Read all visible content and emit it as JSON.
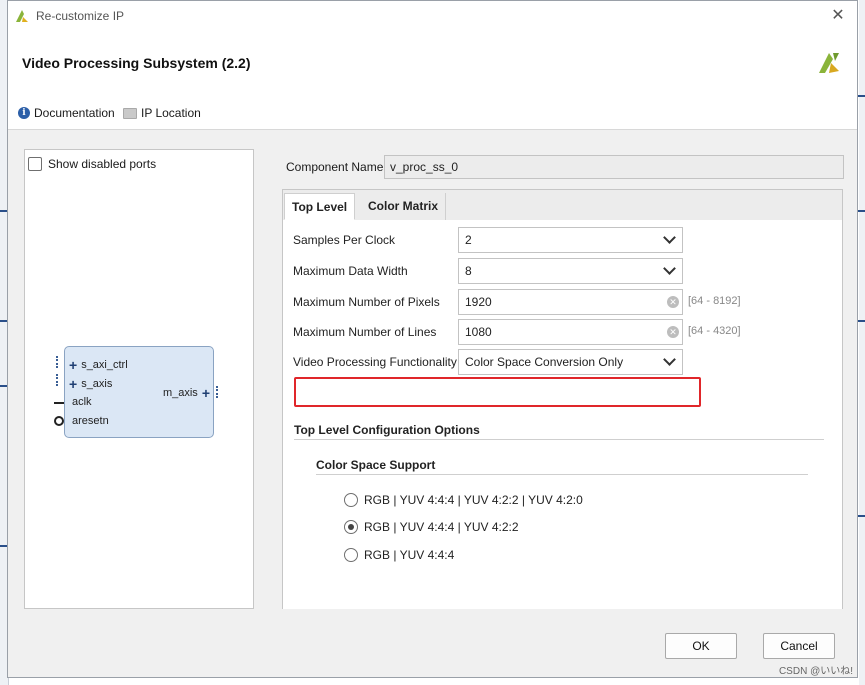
{
  "window": {
    "title": "Re-customize IP",
    "close_icon": "close-icon"
  },
  "header": {
    "ip_title": "Video Processing Subsystem (2.2)",
    "documentation_label": "Documentation",
    "ip_location_label": "IP Location"
  },
  "left_panel": {
    "show_disabled_ports_label": "Show disabled ports",
    "block": {
      "ports_left": [
        "s_axi_ctrl",
        "s_axis",
        "aclk",
        "aresetn"
      ],
      "port_right": "m_axis"
    }
  },
  "component_name": {
    "label": "Component Name",
    "value": "v_proc_ss_0"
  },
  "tabs": [
    {
      "label": "Top Level",
      "active": true
    },
    {
      "label": "Color Matrix",
      "active": false
    }
  ],
  "params": {
    "samples_per_clock": {
      "label": "Samples Per Clock",
      "value": "2"
    },
    "max_data_width": {
      "label": "Maximum Data Width",
      "value": "8"
    },
    "max_pixels": {
      "label": "Maximum Number of Pixels",
      "value": "1920",
      "range": "[64 - 8192]"
    },
    "max_lines": {
      "label": "Maximum Number of Lines",
      "value": "1080",
      "range": "[64 - 4320]"
    },
    "functionality": {
      "label": "Video Processing Functionality",
      "value": "Color Space Conversion Only"
    }
  },
  "config": {
    "section_title": "Top Level Configuration Options",
    "color_space_title": "Color Space Support",
    "options": [
      {
        "label": "RGB | YUV 4:4:4 | YUV 4:2:2 | YUV 4:2:0",
        "selected": false
      },
      {
        "label": "RGB | YUV 4:4:4 | YUV 4:2:2",
        "selected": true
      },
      {
        "label": "RGB | YUV 4:4:4",
        "selected": false
      }
    ]
  },
  "buttons": {
    "ok": "OK",
    "cancel": "Cancel"
  },
  "watermark": "CSDN @いいね!",
  "colors": {
    "highlight": "#e0262a",
    "block_fill": "#dbe7f5",
    "brand": "#8ab43a"
  }
}
